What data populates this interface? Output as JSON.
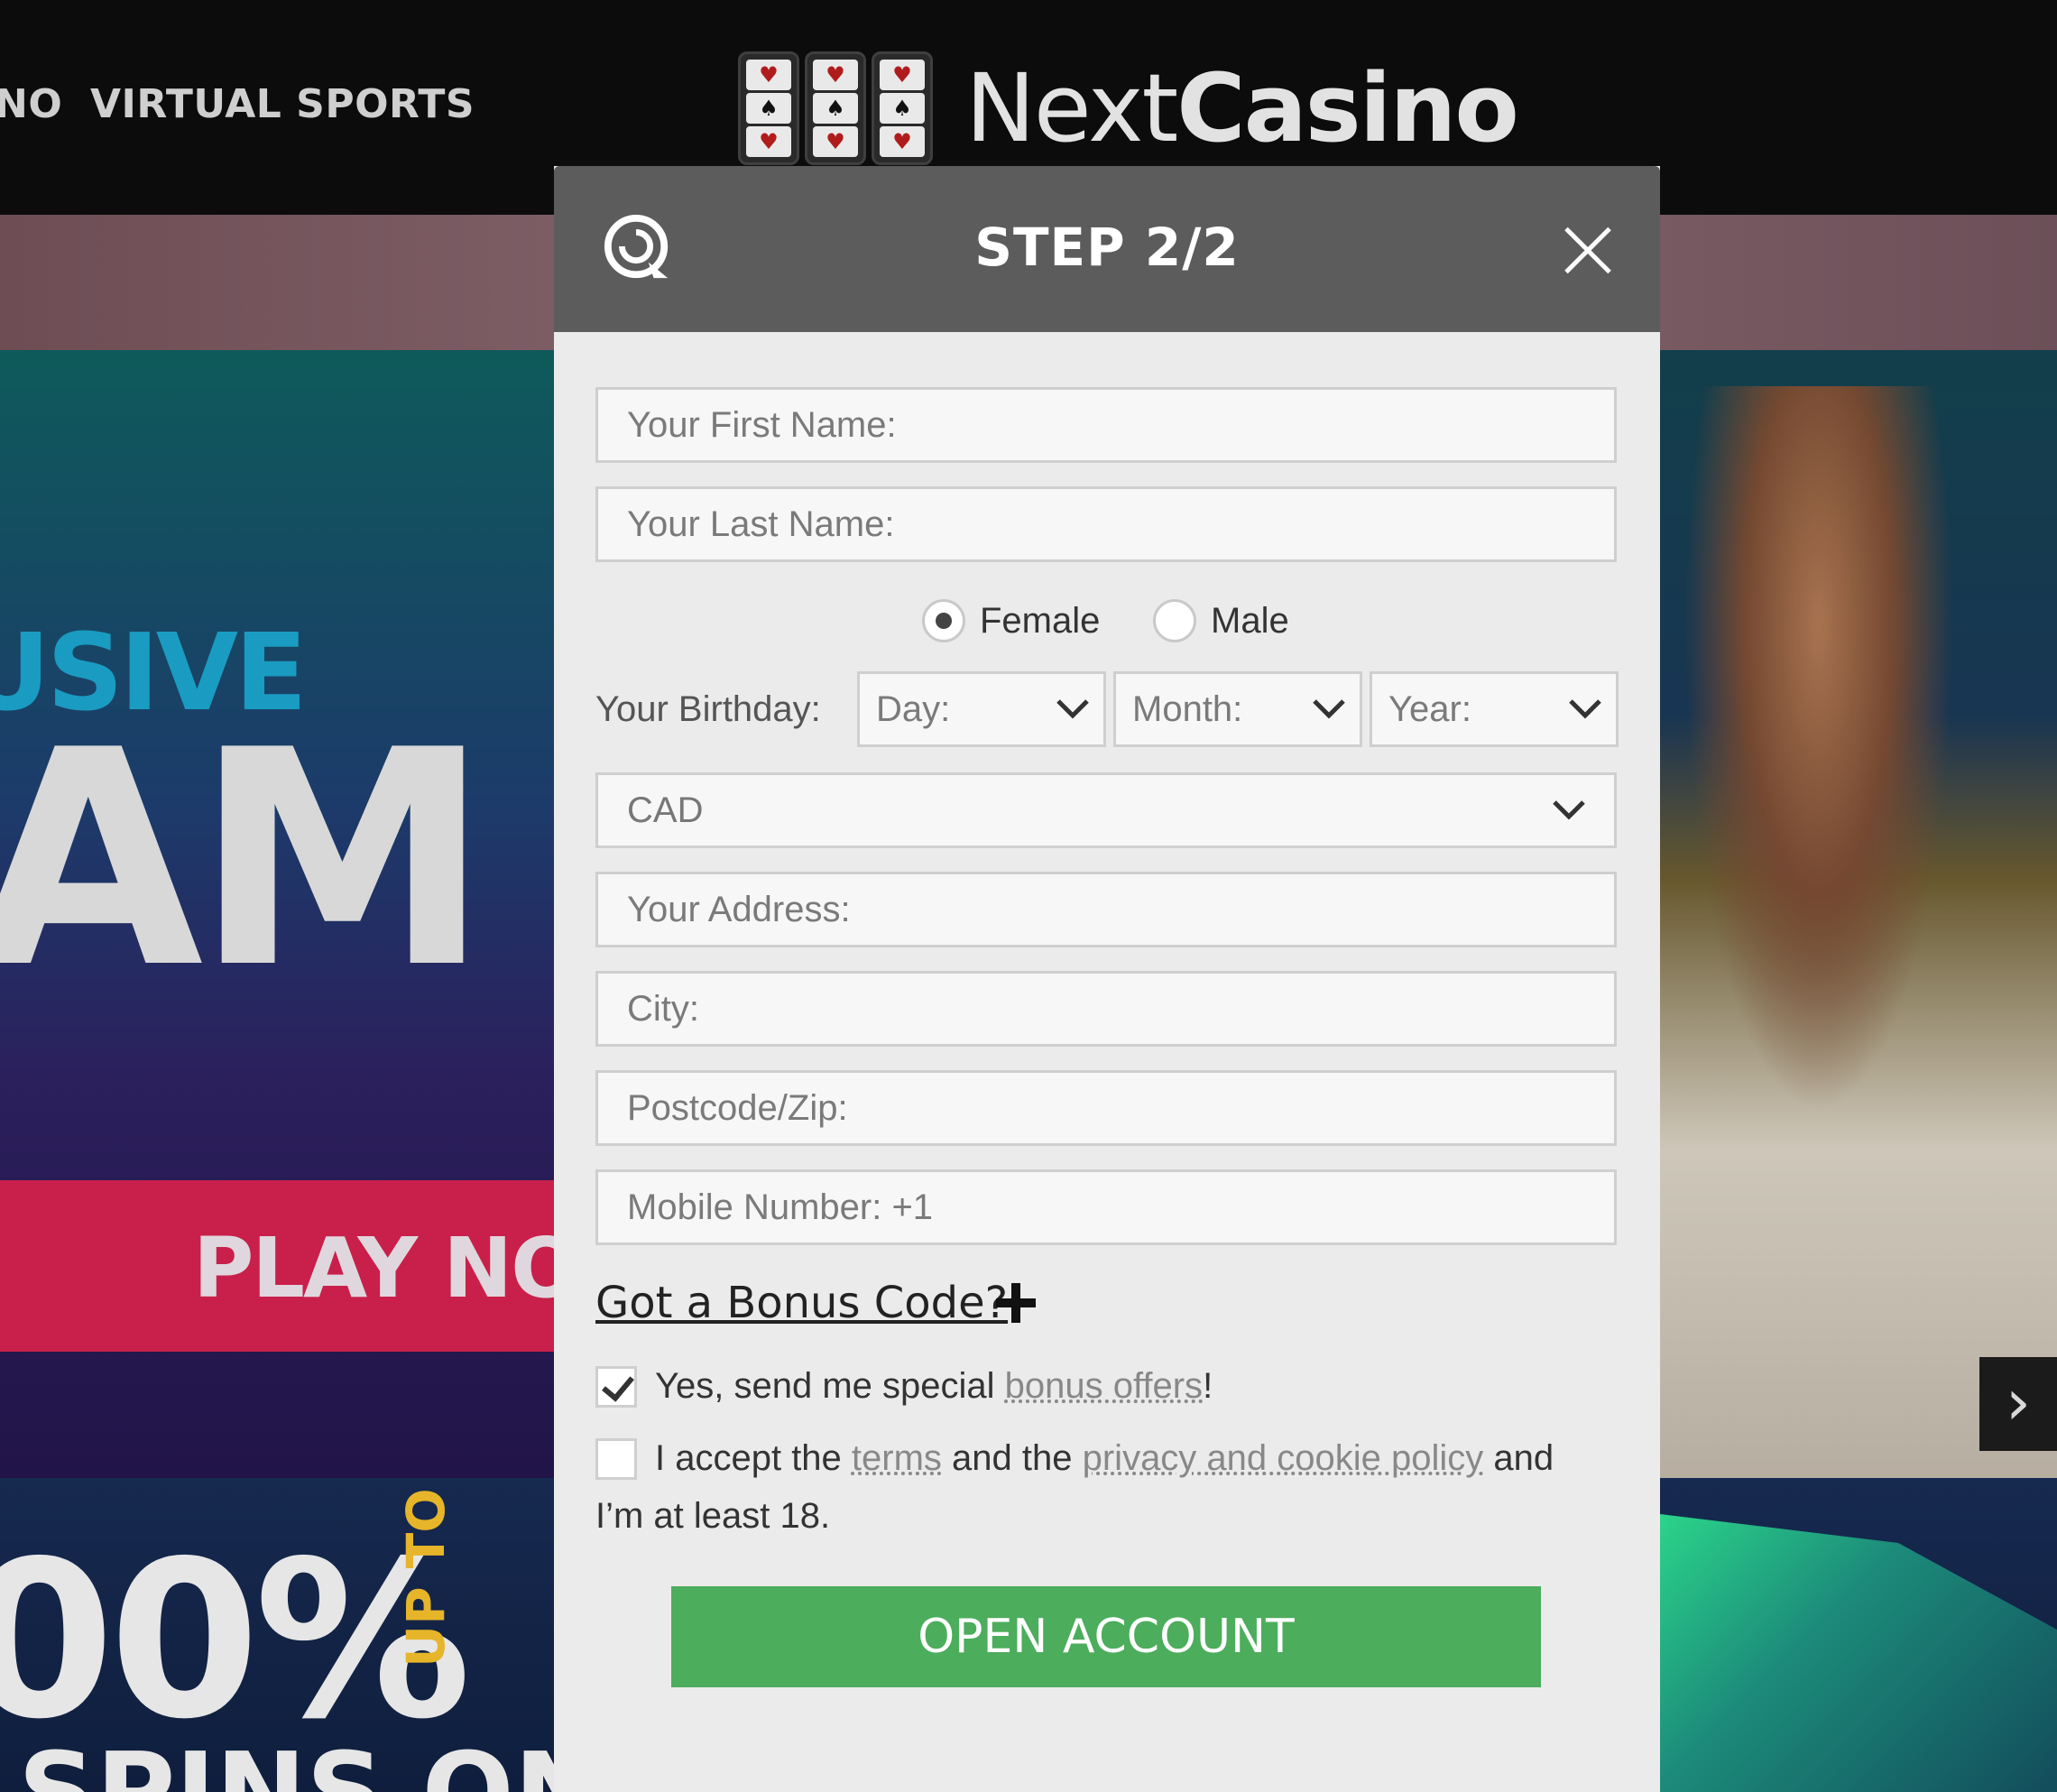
{
  "site": {
    "nav": [
      "NO",
      "VIRTUAL SPORTS"
    ],
    "logo": {
      "part1": "Next",
      "part2": "Casino"
    },
    "hero": {
      "headline_fragment": "USIVE",
      "big_fragment": "AM",
      "cta_fragment": "PLAY NO"
    },
    "promo": {
      "percent_fragment": "00%",
      "up_to": "UP TO",
      "spins_fragment": "SPINS ON"
    }
  },
  "modal": {
    "title": "STEP 2/2",
    "fields": {
      "first_name_placeholder": "Your First Name:",
      "last_name_placeholder": "Your Last Name:",
      "address_placeholder": "Your Address:",
      "city_placeholder": "City:",
      "postcode_placeholder": "Postcode/Zip:",
      "mobile_placeholder": "Mobile Number: +1"
    },
    "gender": {
      "options": [
        "Female",
        "Male"
      ],
      "selected": "Female"
    },
    "birthday": {
      "label": "Your Birthday:",
      "day": "Day:",
      "month": "Month:",
      "year": "Year:"
    },
    "currency": "CAD",
    "bonus_code_label": "Got a Bonus Code?",
    "offers_checkbox": {
      "checked": true,
      "text_before": "Yes, send me special ",
      "link": "bonus offers",
      "text_after": "!"
    },
    "terms_checkbox": {
      "checked": false,
      "text1": "I accept the ",
      "link1": "terms",
      "text2": " and the ",
      "link2": "privacy and cookie policy",
      "text3": " and I’m at least 18."
    },
    "submit_label": "OPEN ACCOUNT"
  },
  "colors": {
    "submit": "#4cad5c",
    "header": "#5c5c5c",
    "promo_accent": "#e6b52a",
    "hero_accent": "#1a9bc2",
    "cta_band": "#c8204a"
  }
}
